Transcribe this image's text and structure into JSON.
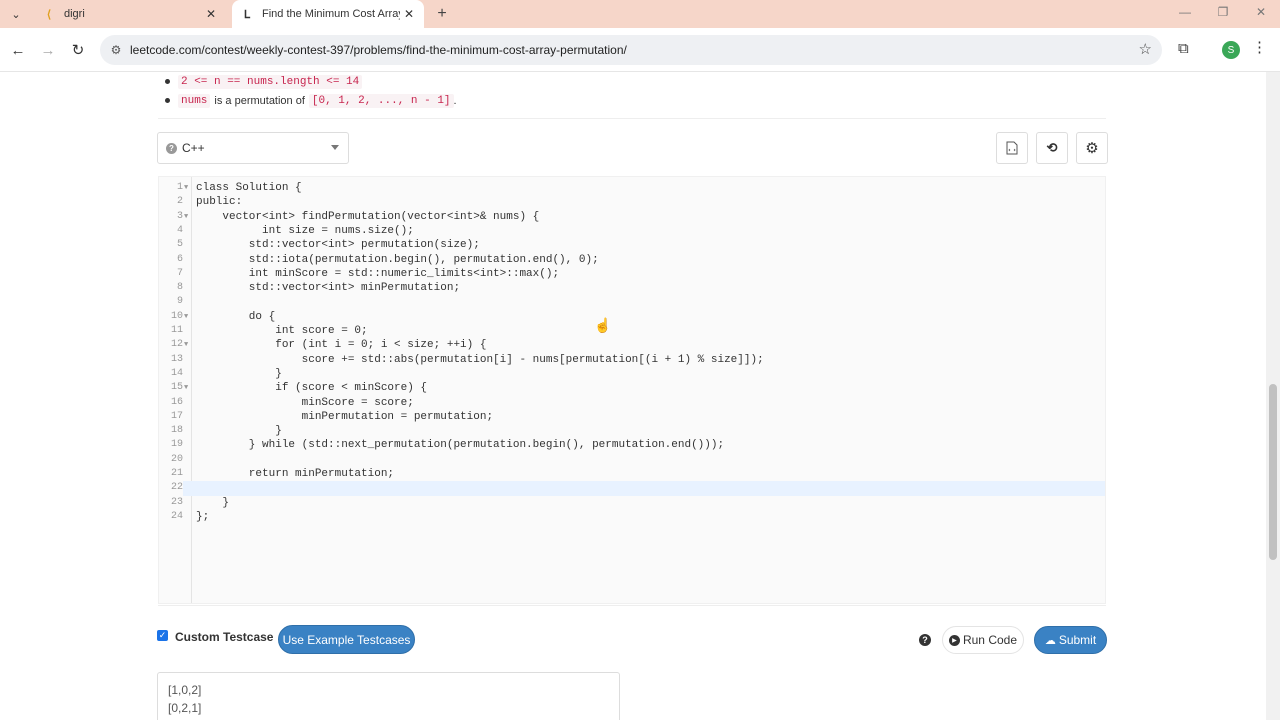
{
  "browser": {
    "tabs": [
      {
        "title": "digri",
        "active": false
      },
      {
        "title": "Find the Minimum Cost Array P",
        "active": true
      }
    ],
    "url": "leetcode.com/contest/weekly-contest-397/problems/find-the-minimum-cost-array-permutation/",
    "profile_initial": "S"
  },
  "constraints": {
    "item1_code": "2 <= n == nums.length <= 14",
    "item2_code_a": "nums",
    "item2_text": "is a permutation of",
    "item2_code_b": "[0, 1, 2, ..., n - 1]",
    "item2_end": "."
  },
  "editor": {
    "language": "C++",
    "lines": [
      {
        "n": "1",
        "fold": true,
        "text": "class Solution {"
      },
      {
        "n": "2",
        "fold": false,
        "text": "public:"
      },
      {
        "n": "3",
        "fold": true,
        "text": "    vector<int> findPermutation(vector<int>& nums) {"
      },
      {
        "n": "4",
        "fold": false,
        "text": "          int size = nums.size();"
      },
      {
        "n": "5",
        "fold": false,
        "text": "        std::vector<int> permutation(size);"
      },
      {
        "n": "6",
        "fold": false,
        "text": "        std::iota(permutation.begin(), permutation.end(), 0);"
      },
      {
        "n": "7",
        "fold": false,
        "text": "        int minScore = std::numeric_limits<int>::max();"
      },
      {
        "n": "8",
        "fold": false,
        "text": "        std::vector<int> minPermutation;"
      },
      {
        "n": "9",
        "fold": false,
        "text": ""
      },
      {
        "n": "10",
        "fold": true,
        "text": "        do {"
      },
      {
        "n": "11",
        "fold": false,
        "text": "            int score = 0;"
      },
      {
        "n": "12",
        "fold": true,
        "text": "            for (int i = 0; i < size; ++i) {"
      },
      {
        "n": "13",
        "fold": false,
        "text": "                score += std::abs(permutation[i] - nums[permutation[(i + 1) % size]]);"
      },
      {
        "n": "14",
        "fold": false,
        "text": "            }"
      },
      {
        "n": "15",
        "fold": true,
        "text": "            if (score < minScore) {"
      },
      {
        "n": "16",
        "fold": false,
        "text": "                minScore = score;"
      },
      {
        "n": "17",
        "fold": false,
        "text": "                minPermutation = permutation;"
      },
      {
        "n": "18",
        "fold": false,
        "text": "            }"
      },
      {
        "n": "19",
        "fold": false,
        "text": "        } while (std::next_permutation(permutation.begin(), permutation.end()));"
      },
      {
        "n": "20",
        "fold": false,
        "text": ""
      },
      {
        "n": "21",
        "fold": false,
        "text": "        return minPermutation;"
      },
      {
        "n": "22",
        "fold": false,
        "text": ""
      },
      {
        "n": "23",
        "fold": false,
        "text": "    }"
      },
      {
        "n": "24",
        "fold": false,
        "text": "};"
      }
    ],
    "active_line": "22"
  },
  "actions": {
    "custom_testcase_label": "Custom Testcase",
    "custom_testcase_checked": true,
    "use_example_label": "Use Example Testcases",
    "run_label": "Run Code",
    "submit_label": "Submit"
  },
  "testcase": {
    "lines": [
      "[1,0,2]",
      "[0,2,1]"
    ]
  }
}
